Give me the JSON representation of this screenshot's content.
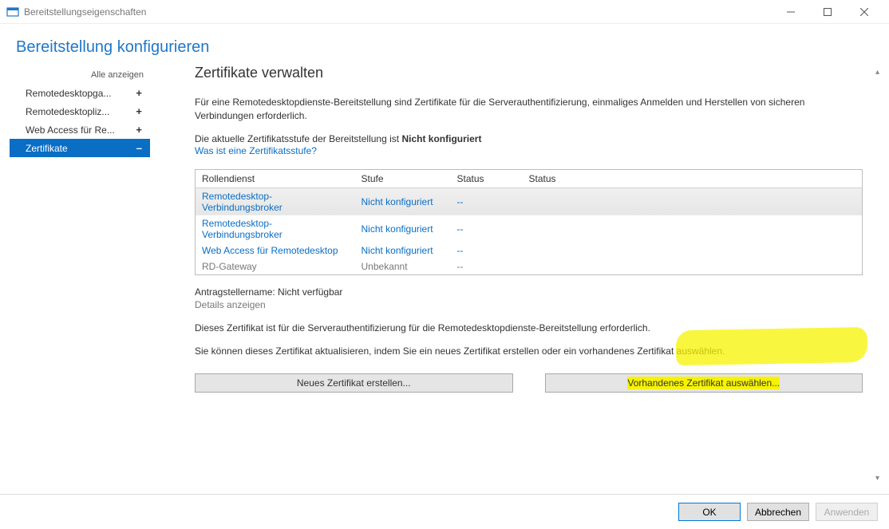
{
  "window": {
    "title": "Bereitstellungseigenschaften"
  },
  "page_heading": "Bereitstellung konfigurieren",
  "sidebar": {
    "show_all": "Alle anzeigen",
    "items": [
      {
        "label": "Remotedesktopga...",
        "expand": "+"
      },
      {
        "label": "Remotedesktopliz...",
        "expand": "+"
      },
      {
        "label": "Web Access für Re...",
        "expand": "+"
      },
      {
        "label": "Zertifikate",
        "expand": "–"
      }
    ]
  },
  "content": {
    "heading": "Zertifikate verwalten",
    "intro": "Für eine Remotedesktopdienste-Bereitstellung sind Zertifikate für die Serverauthentifizierung, einmaliges Anmelden und Herstellen von sicheren Verbindungen erforderlich.",
    "level_prefix": "Die aktuelle Zertifikatsstufe der Bereitstellung ist ",
    "level_value": "Nicht konfiguriert",
    "what_is_link": "Was ist eine Zertifikatsstufe?",
    "table": {
      "headers": [
        "Rollendienst",
        "Stufe",
        "Status",
        "Status"
      ],
      "rows": [
        {
          "role": "Remotedesktop-Verbindungsbroker",
          "level": "Nicht konfiguriert",
          "s1": "--",
          "s2": "",
          "selected": true,
          "gray": false
        },
        {
          "role": "Remotedesktop-Verbindungsbroker",
          "level": "Nicht konfiguriert",
          "s1": "--",
          "s2": "",
          "selected": false,
          "gray": false
        },
        {
          "role": "Web Access für Remotedesktop",
          "level": "Nicht konfiguriert",
          "s1": "--",
          "s2": "",
          "selected": false,
          "gray": false
        },
        {
          "role": "RD-Gateway",
          "level": "Unbekannt",
          "s1": "--",
          "s2": "",
          "selected": false,
          "gray": true
        }
      ]
    },
    "subject_name": "Antragstellername: Nicht verfügbar",
    "details_link": "Details anzeigen",
    "required_text": "Dieses Zertifikat ist für die Serverauthentifizierung für die Remotedesktopdienste-Bereitstellung erforderlich.",
    "update_text": "Sie können dieses Zertifikat aktualisieren, indem Sie ein neues Zertifikat erstellen oder ein vorhandenes Zertifikat auswählen.",
    "btn_new": "Neues Zertifikat erstellen...",
    "btn_existing": "Vorhandenes Zertifikat auswählen..."
  },
  "footer": {
    "ok": "OK",
    "cancel": "Abbrechen",
    "apply": "Anwenden"
  }
}
